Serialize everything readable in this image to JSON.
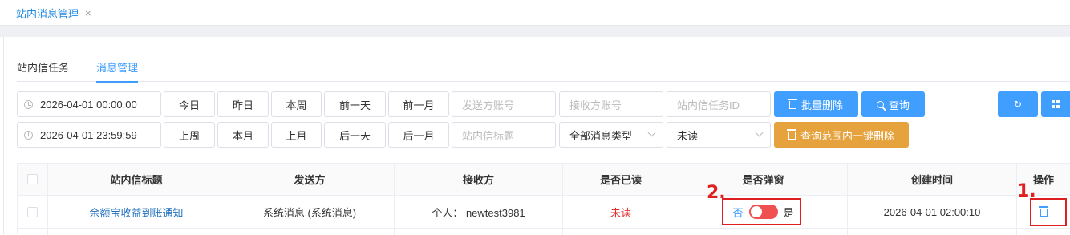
{
  "top_tab": {
    "label": "站内消息管理",
    "close": "×"
  },
  "sub_tabs": [
    "站内信任务",
    "消息管理"
  ],
  "filters": {
    "start_time": "2026-04-01 00:00:00",
    "end_time": "2026-04-01 23:59:59",
    "quick_row1": [
      "今日",
      "昨日",
      "本周",
      "前一天",
      "前一月"
    ],
    "quick_row2": [
      "上周",
      "本月",
      "上月",
      "后一天",
      "后一月"
    ],
    "sender_placeholder": "发送方账号",
    "receiver_placeholder": "接收方账号",
    "task_id_placeholder": "站内信任务ID",
    "title_placeholder": "站内信标题",
    "msg_type": "全部消息类型",
    "read_status": "未读"
  },
  "buttons": {
    "batch_delete": "批量删除",
    "query": "查询",
    "range_delete": "查询范围内一键删除"
  },
  "table": {
    "headers": [
      "站内信标题",
      "发送方",
      "接收方",
      "是否已读",
      "是否弹窗",
      "创建时间",
      "操作"
    ],
    "rows": [
      {
        "title": "余额宝收益到账通知",
        "sender": "系统消息 (系统消息)",
        "receiver": "个人： newtest3981",
        "read": "未读",
        "popup_off": "否",
        "popup_on": "是",
        "created": "2026-04-01 02:00:10"
      }
    ]
  },
  "annotations": [
    "1.",
    "2."
  ],
  "colors": {
    "primary": "#409eff",
    "warning": "#e6a23c",
    "danger": "#e03131",
    "annotation": "#e02020"
  }
}
